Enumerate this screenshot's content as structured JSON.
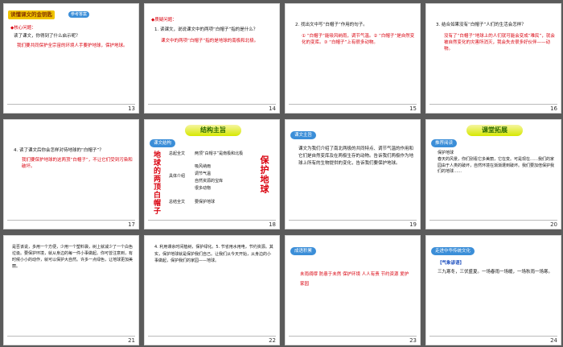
{
  "slides": [
    {
      "num": "13",
      "title": "读懂课文的金钥匙",
      "badge": "参考答案",
      "head": "◆核心问题：",
      "q": "读了课文，你得到了什么启示呢？",
      "a": "我们要共同保护全宗宙的环境人手要护地球，保护地球。"
    },
    {
      "num": "14",
      "head": "◆质疑问题：",
      "q": "1. 读课文，说说课文中的两项“白帽子”指的是什么？",
      "a": "课文中的两项“白帽子”指的是地球的南极和北极。"
    },
    {
      "num": "15",
      "q": "2. 找出文中写“白帽子”作用的句子。",
      "a": "① “白帽子”能吸风纳雨，调节气温。② “白帽子”是自然变化的变库。③ “白帽子”上有很多动物。"
    },
    {
      "num": "16",
      "q": "3. 结合如果没有“白帽子”人们的生活会怎样？",
      "a": "没有了“白帽子”地球上的人们就可能会变成“难民”，就会被自然变化的灾害所消灭，我会失去很多好伙伴——动物。"
    },
    {
      "num": "17",
      "q": "4. 读了课文后你会怎样对待地球的“白帽子”？",
      "a": "我们要保护地球的这两顶“白帽子”，不让它们受到污染和破坏。"
    },
    {
      "num": "18",
      "head": "结构主旨",
      "tag": "课文结构",
      "vert_left": "地球的两顶白帽子",
      "vert_right": "保护地球",
      "items": [
        "总起全文",
        "两顶“白帽子”是南极和北极",
        "具体介绍",
        "吸风纳雨",
        "调节气温",
        "自然资源的宝库",
        "很多动物",
        "总结全文",
        "要保护地球"
      ]
    },
    {
      "num": "19",
      "tag": "课文主旨",
      "a": "课文为我们介绍了南北两极的共同特点、调节气温的作用和它们是自然变库及在两极生存的动物。告诉我们两极作为地球上所有的生物提供的变化，告诉我们要保护地球。"
    },
    {
      "num": "20",
      "head": "课堂拓展",
      "tag": "推荐阅读",
      "sub": "保护地球",
      "a": "春天的风景，你们别看它多美丽，它在变。可是现在……我们的家园由于人类的破坏，自然环境在渐渐遭到破坏。我们要加倍保护我们的地球……"
    },
    {
      "num": "21",
      "a": "是否该说，多用一个方便，少用一个塑料袋，树上就减少了一个白色垃圾。要保护环境，就从身边的每一件小事做起。你可曾注意到，有时候小小的动作，就可以保护大自然。许多一点绿色，让地球更加美丽。"
    },
    {
      "num": "22",
      "a": "4. 利用课余时间植树，保护绿化。5. 节省用水用电，节约资源。其实，保护地球就是保护我们自己。让我们从今天开始，从身边的小事做起，保护我们的家园——地球。"
    },
    {
      "num": "23",
      "tag": "成语积累",
      "a": "未雨绸缪  防患于未然  保护环境  人人有责  节约资源  爱护家园"
    },
    {
      "num": "24",
      "tag": "走进中华传统文化",
      "sub": "【气象谚语】",
      "a": "三九寒冬，三伏盛夏。一场春雨一场暖，一场秋雨一场寒。"
    }
  ]
}
